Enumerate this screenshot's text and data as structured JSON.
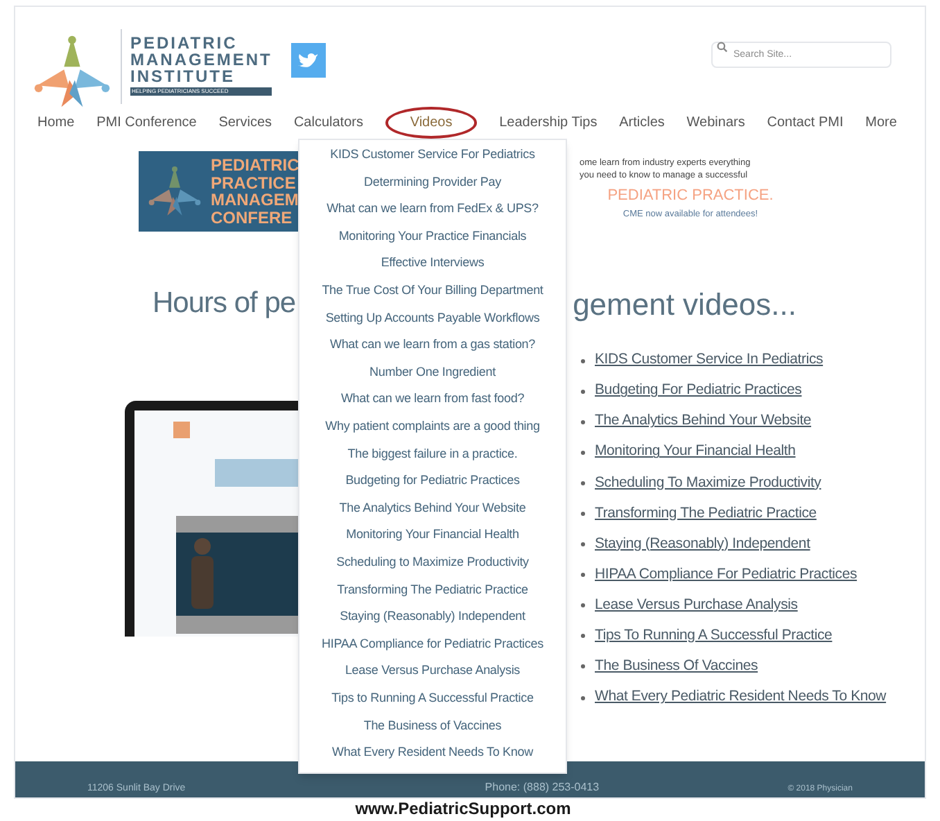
{
  "header": {
    "logo_lines": [
      "PEDIATRIC",
      "MANAGEMENT",
      "INSTITUTE"
    ],
    "tagline": "HELPING PEDIATRICIANS SUCCEED",
    "search": {
      "placeholder": "Search Site..."
    }
  },
  "nav": [
    {
      "label": "Home",
      "selected": false
    },
    {
      "label": "PMI Conference",
      "selected": false
    },
    {
      "label": "Services",
      "selected": false
    },
    {
      "label": "Calculators",
      "selected": false
    },
    {
      "label": "Videos",
      "selected": true
    },
    {
      "label": "Leadership Tips",
      "selected": false
    },
    {
      "label": "Articles",
      "selected": false
    },
    {
      "label": "Webinars",
      "selected": false
    },
    {
      "label": "Contact PMI",
      "selected": false
    },
    {
      "label": "More",
      "selected": false
    }
  ],
  "banner": {
    "title_lines": [
      "PEDIATRIC",
      "PRACTICE",
      "MANAGEM",
      "CONFERE"
    ],
    "intro_lines": [
      "ome learn from industry experts everything",
      "you need to know to manage a successful"
    ],
    "highlight": "PEDIATRIC PRACTICE.",
    "note": "CME now available for attendees!"
  },
  "heading": {
    "left": "Hours of pe",
    "right": "gement videos..."
  },
  "video_links": [
    "KIDS Customer Service In Pediatrics",
    "Budgeting For Pediatric Practices",
    "The Analytics Behind Your Website",
    "Monitoring Your Financial Health",
    "Scheduling To Maximize Productivity",
    "Transforming The Pediatric Practice",
    "Staying (Reasonably) Independent",
    "HIPAA Compliance For Pediatric Practices",
    "Lease Versus Purchase Analysis",
    "Tips To Running A Successful Practice",
    "The Business Of Vaccines",
    "What Every Pediatric Resident Needs To Know"
  ],
  "dropdown": {
    "items": [
      "KIDS Customer Service For Pediatrics",
      "Determining Provider Pay",
      "What can we learn from FedEx & UPS?",
      "Monitoring Your Practice Financials",
      "Effective Interviews",
      "The True Cost Of Your Billing Department",
      "Setting Up Accounts Payable Workflows",
      "What can we learn from a gas station?",
      "Number One Ingredient",
      "What can we learn from fast food?",
      "Why patient complaints are a good thing",
      "The biggest failure in a practice.",
      "Budgeting for Pediatric Practices",
      "The Analytics Behind Your Website",
      "Monitoring Your Financial Health",
      "Scheduling to Maximize Productivity",
      "Transforming The Pediatric Practice",
      "Staying (Reasonably) Independent",
      "HIPAA Compliance for Pediatric Practices",
      "Lease Versus Purchase Analysis",
      "Tips to Running A Successful Practice",
      "The Business of Vaccines",
      "What Every Resident Needs To Know"
    ]
  },
  "footer": {
    "address": "11206 Sunlit Bay Drive",
    "phone": "Phone: (888) 253-0413",
    "copyright": "© 2018 Physician"
  },
  "caption": "www.PediatricSupport.com"
}
